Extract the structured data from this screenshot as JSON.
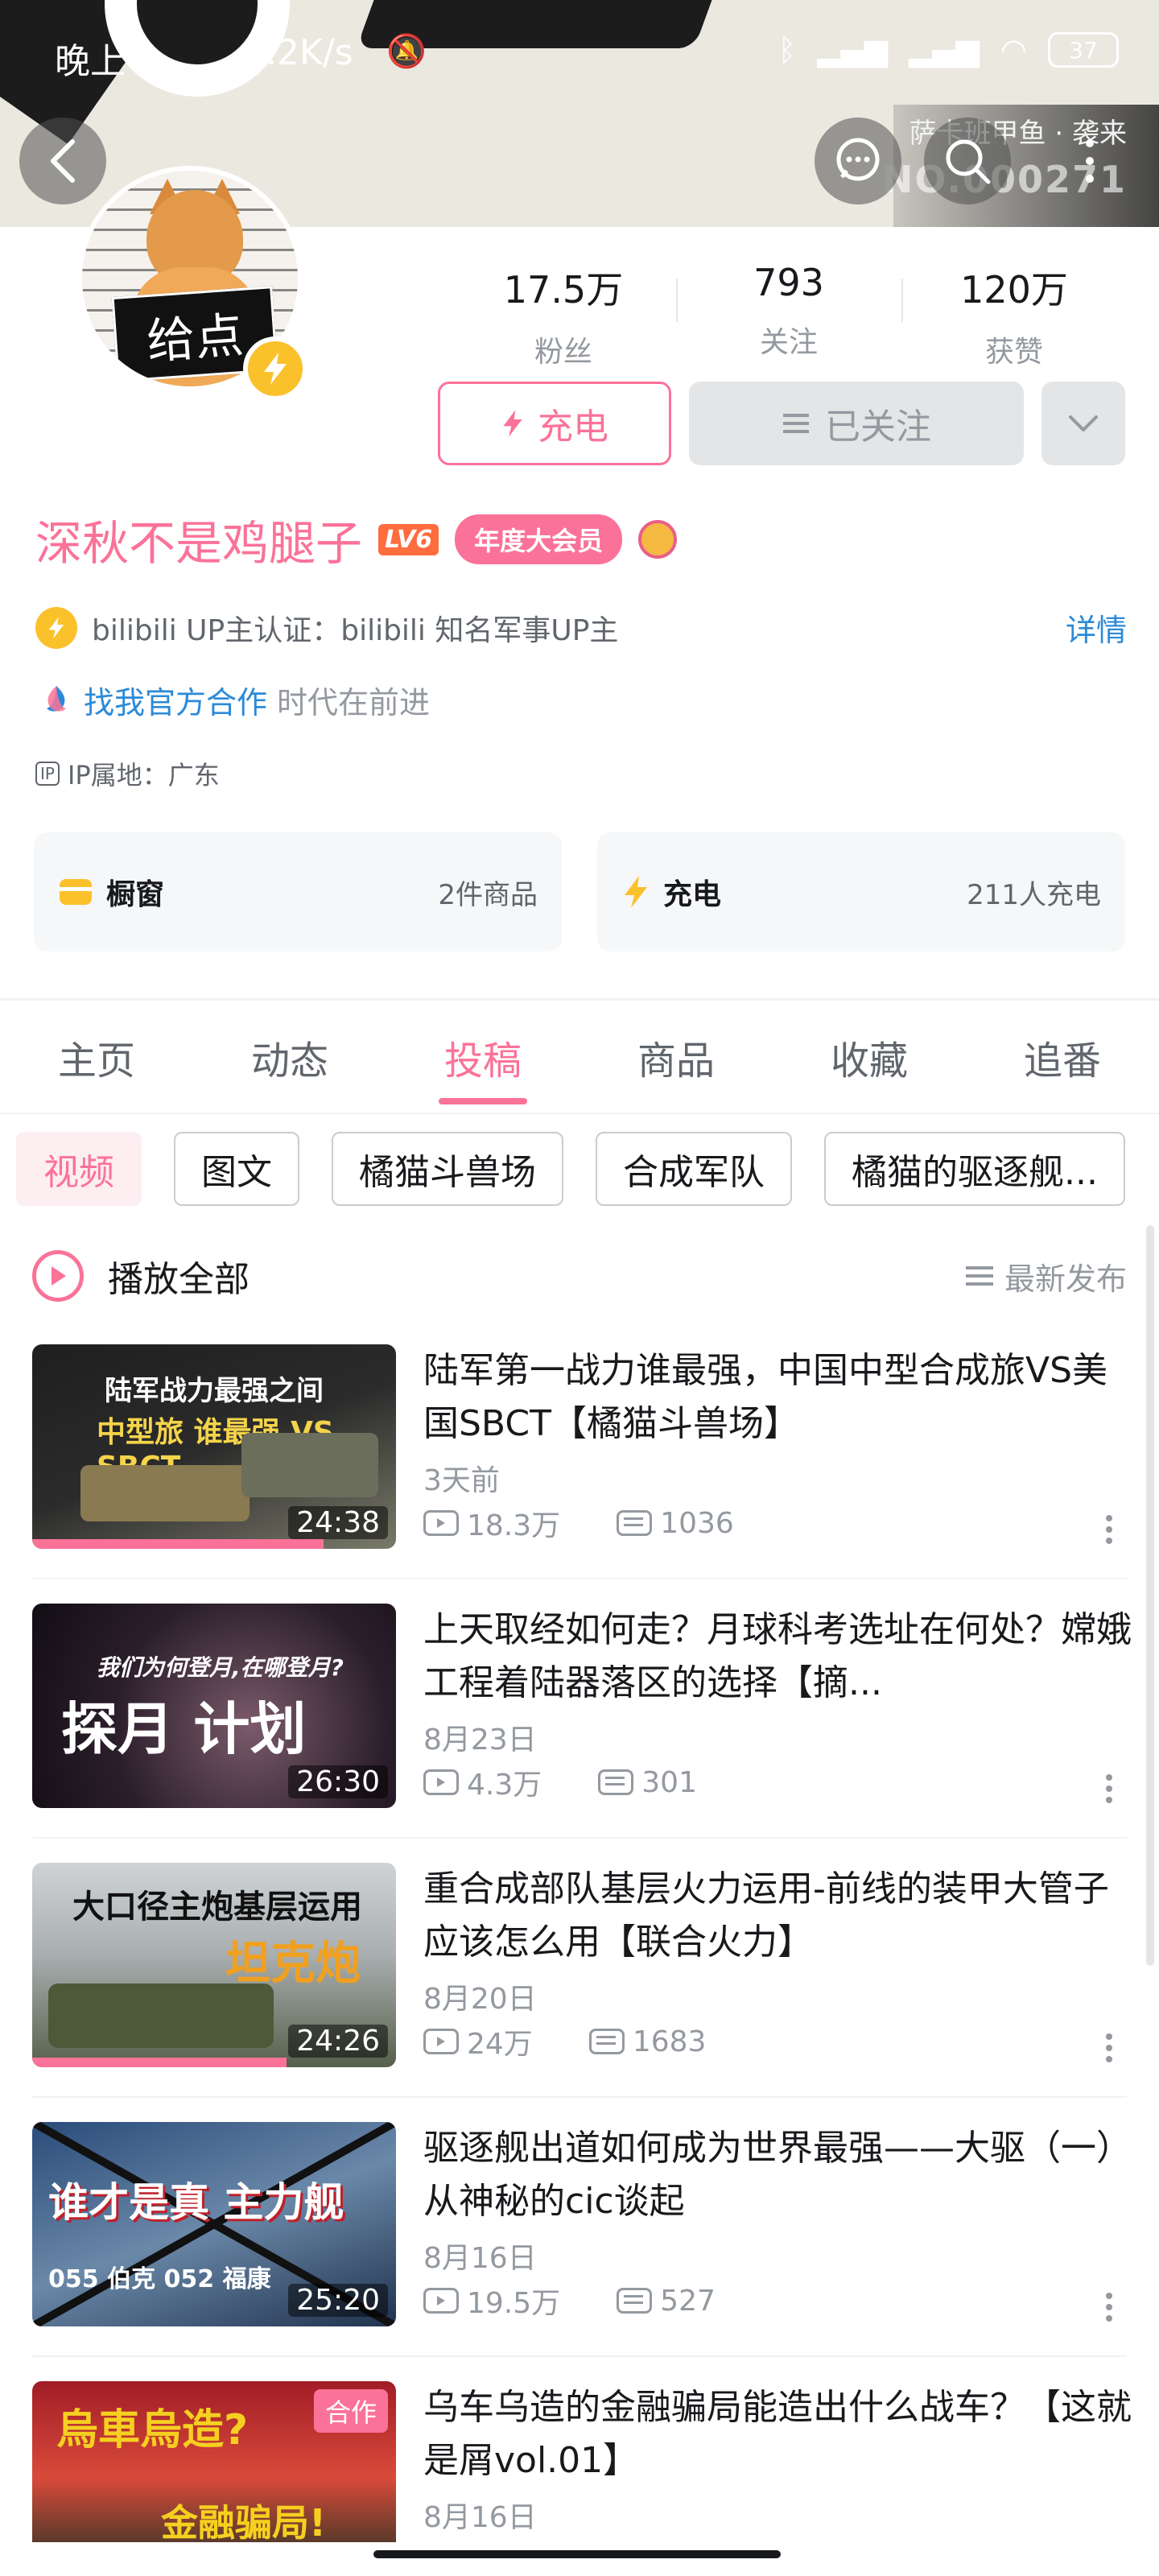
{
  "status_bar": {
    "time": "晚上",
    "speed": ".2K/s",
    "battery": "37"
  },
  "banner": {
    "caption": "萨卡班甲鱼 · 袭来",
    "number": "NO.000271"
  },
  "avatar": {
    "sign_text": "给点"
  },
  "stats": [
    {
      "value": "17.5万",
      "label": "粉丝"
    },
    {
      "value": "793",
      "label": "关注"
    },
    {
      "value": "120万",
      "label": "获赞"
    }
  ],
  "actions": {
    "charge_label": "充电",
    "followed_label": "已关注"
  },
  "profile": {
    "username": "深秋不是鸡腿子",
    "level": "LV6",
    "vip": "年度大会员",
    "cert_text": "bilibili UP主认证：bilibili 知名军事UP主",
    "cert_detail": "详情",
    "coop_link": "找我官方合作",
    "coop_rest": "时代在前进",
    "ip_tag": "IP",
    "ip_text": "IP属地：广东"
  },
  "cards": [
    {
      "title": "橱窗",
      "sub": "2件商品"
    },
    {
      "title": "充电",
      "sub": "211人充电"
    }
  ],
  "tabs": [
    "主页",
    "动态",
    "投稿",
    "商品",
    "收藏",
    "追番"
  ],
  "active_tab": "投稿",
  "chips": [
    "视频",
    "图文",
    "橘猫斗兽场",
    "合成军队",
    "橘猫的驱逐舰..."
  ],
  "playall": {
    "label": "播放全部",
    "sort": "最新发布"
  },
  "videos": [
    {
      "title": "陆军第一战力谁最强，中国中型合成旅VS美国SBCT【橘猫斗兽场】",
      "date": "3天前",
      "plays": "18.3万",
      "danmaku": "1036",
      "duration": "24:38",
      "progress": 0.8,
      "thumb_text": "陆军战力最强之间",
      "thumb_text2": "中型旅 谁最强 VS SBCT"
    },
    {
      "title": "上天取经如何走？月球科考选址在何处？嫦娥工程着陆器落区的选择【摘...",
      "date": "8月23日",
      "plays": "4.3万",
      "danmaku": "301",
      "duration": "26:30",
      "progress": 0,
      "thumb_text": "我们为何登月,在哪登月?",
      "thumb_text2": "探月 计划"
    },
    {
      "title": "重合成部队基层火力运用-前线的装甲大管子应该怎么用【联合火力】",
      "date": "8月20日",
      "plays": "24万",
      "danmaku": "1683",
      "duration": "24:26",
      "progress": 0.7,
      "thumb_text": "大口径主炮基层运用",
      "thumb_text2": "坦克炮"
    },
    {
      "title": "驱逐舰出道如何成为世界最强——大驱（一）从神秘的cic谈起",
      "date": "8月16日",
      "plays": "19.5万",
      "danmaku": "527",
      "duration": "25:20",
      "progress": 0,
      "thumb_text": "谁才是真 主力舰",
      "thumb_text2": "055 伯克 052 福康"
    },
    {
      "title": "乌车乌造的金融骗局能造出什么战车？【这就是屑vol.01】",
      "date": "8月16日",
      "coop": "合作",
      "thumb_text": "烏車烏造?",
      "thumb_text2": "金融骗局!"
    }
  ],
  "colors": {
    "accent": "#fb7299",
    "link": "#2c8ad8",
    "gold": "#fbc12b"
  }
}
